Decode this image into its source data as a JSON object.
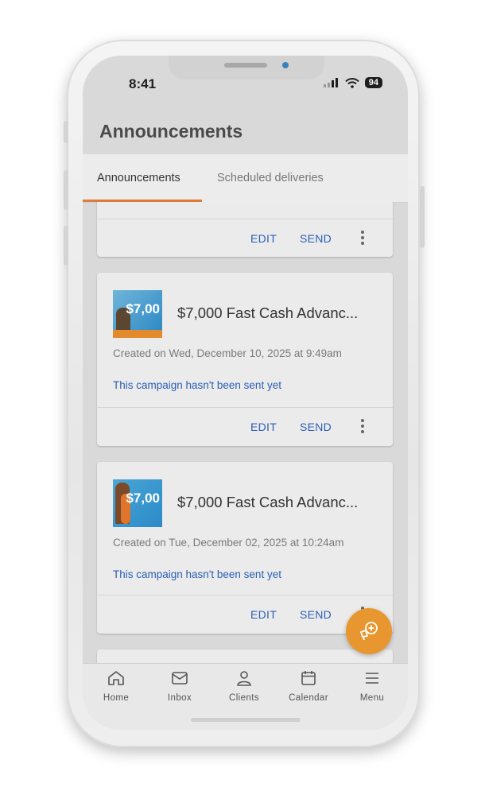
{
  "status_bar": {
    "time": "8:41",
    "battery": "94"
  },
  "header": {
    "title": "Announcements"
  },
  "tabs": [
    {
      "label": "Announcements",
      "active": true
    },
    {
      "label": "Scheduled deliveries",
      "active": false
    }
  ],
  "actions": {
    "edit": "EDIT",
    "send": "SEND"
  },
  "announcements": [
    {
      "title": "$7,000 Fast Cash Advanc...",
      "created": "Created on Wed, December 10, 2025 at 9:49am",
      "status": "This campaign hasn't been sent yet",
      "thumb_text": "$7,00"
    },
    {
      "title": "$7,000 Fast Cash Advanc...",
      "created": "Created on Tue, December 02, 2025 at 10:24am",
      "status": "This campaign hasn't been sent yet",
      "thumb_text": "$7,00"
    }
  ],
  "bottom_nav": [
    {
      "label": "Home",
      "icon": "home-icon"
    },
    {
      "label": "Inbox",
      "icon": "inbox-icon"
    },
    {
      "label": "Clients",
      "icon": "person-icon"
    },
    {
      "label": "Calendar",
      "icon": "calendar-icon"
    },
    {
      "label": "Menu",
      "icon": "hamburger-icon"
    }
  ],
  "colors": {
    "accent": "#e07a38",
    "link": "#2b5fb5",
    "fab": "#e8962f"
  }
}
